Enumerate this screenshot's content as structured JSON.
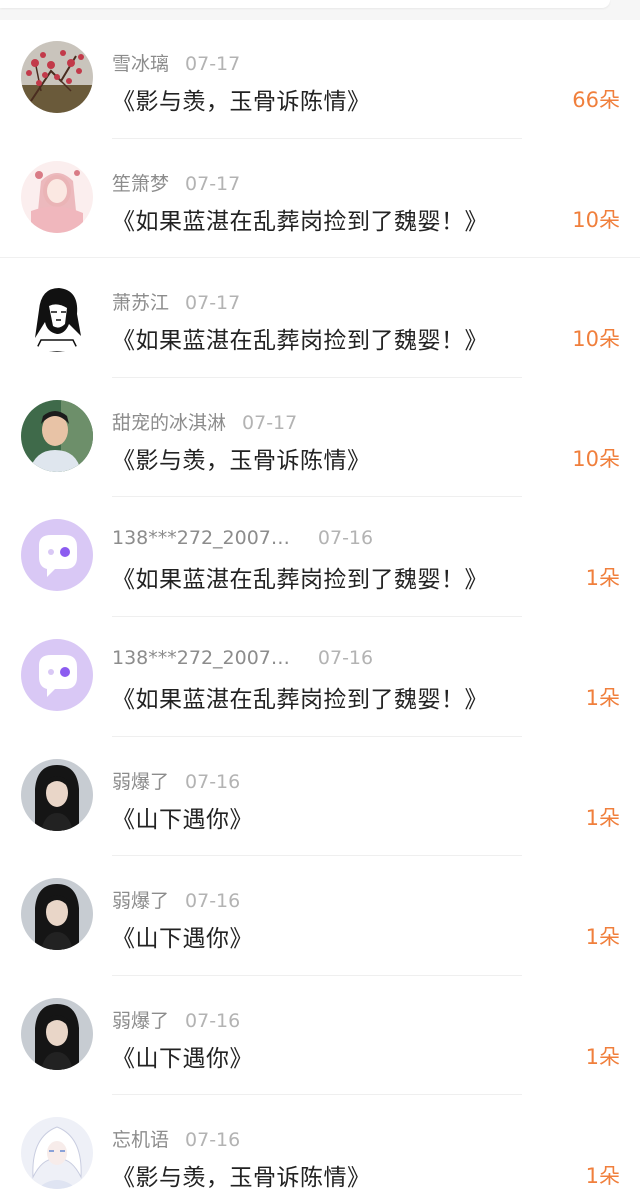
{
  "colors": {
    "accent": "#f07f3c",
    "name_text": "#8c8c8c",
    "date_text": "#b3b3b3",
    "title_text": "#222222",
    "default_avatar_bg": "#d9c8f5"
  },
  "items": [
    {
      "name": "雪冰璃",
      "date": "07-17",
      "title": "《影与羡，玉骨诉陈情》",
      "count": "66朵",
      "avatar": "plum-blossom-photo"
    },
    {
      "name": "笙箫梦",
      "date": "07-17",
      "title": "《如果蓝湛在乱葬岗捡到了魏婴！》",
      "count": "10朵",
      "avatar": "pink-anime-girl"
    },
    {
      "name": "萧苏江",
      "date": "07-17",
      "title": "《如果蓝湛在乱葬岗捡到了魏婴！》",
      "count": "10朵",
      "avatar": "lineart-portrait"
    },
    {
      "name": "甜宠的冰淇淋",
      "date": "07-17",
      "title": "《影与羡，玉骨诉陈情》",
      "count": "10朵",
      "avatar": "young-man-photo"
    },
    {
      "name": "138***272_2007…",
      "date": "07-16",
      "title": "《如果蓝湛在乱葬岗捡到了魏婴！》",
      "count": "1朵",
      "avatar": "default-chat-avatar"
    },
    {
      "name": "138***272_2007…",
      "date": "07-16",
      "title": "《如果蓝湛在乱葬岗捡到了魏婴！》",
      "count": "1朵",
      "avatar": "default-chat-avatar"
    },
    {
      "name": "弱爆了",
      "date": "07-16",
      "title": "《山下遇你》",
      "count": "1朵",
      "avatar": "dark-costume-portrait"
    },
    {
      "name": "弱爆了",
      "date": "07-16",
      "title": "《山下遇你》",
      "count": "1朵",
      "avatar": "dark-costume-portrait"
    },
    {
      "name": "弱爆了",
      "date": "07-16",
      "title": "《山下遇你》",
      "count": "1朵",
      "avatar": "dark-costume-portrait"
    },
    {
      "name": "忘机语",
      "date": "07-16",
      "title": "《影与羡，玉骨诉陈情》",
      "count": "1朵",
      "avatar": "white-hair-anime"
    }
  ]
}
